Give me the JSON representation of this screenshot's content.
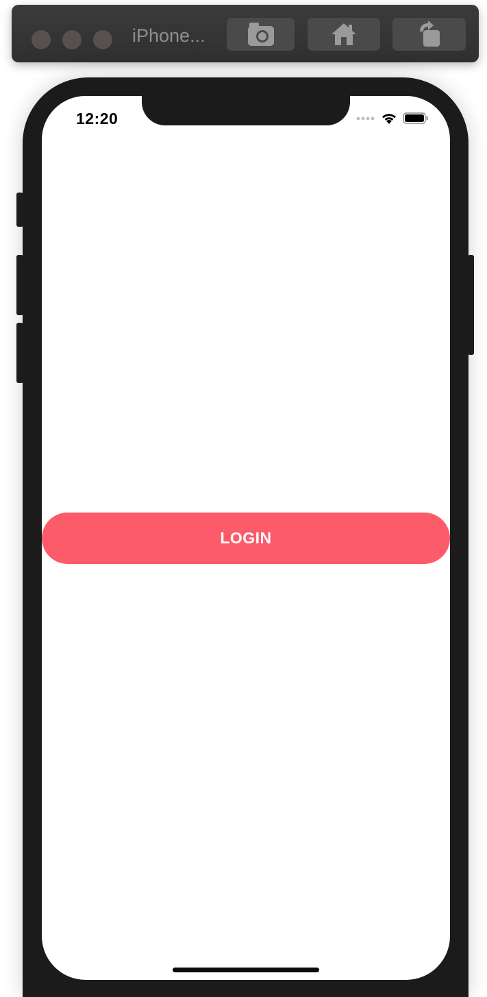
{
  "toolbar": {
    "device_name": "iPhone...",
    "buttons": {
      "screenshot_icon": "camera-icon",
      "home_icon": "home-icon",
      "rotate_icon": "rotate-icon"
    }
  },
  "status_bar": {
    "time": "12:20",
    "icons": [
      "signal-dots-icon",
      "wifi-icon",
      "battery-icon"
    ]
  },
  "main": {
    "login_label": "LOGIN"
  },
  "colors": {
    "accent": "#fc5b6a",
    "device_frame": "#1b1b1b",
    "toolbar_bg": "#333333"
  }
}
